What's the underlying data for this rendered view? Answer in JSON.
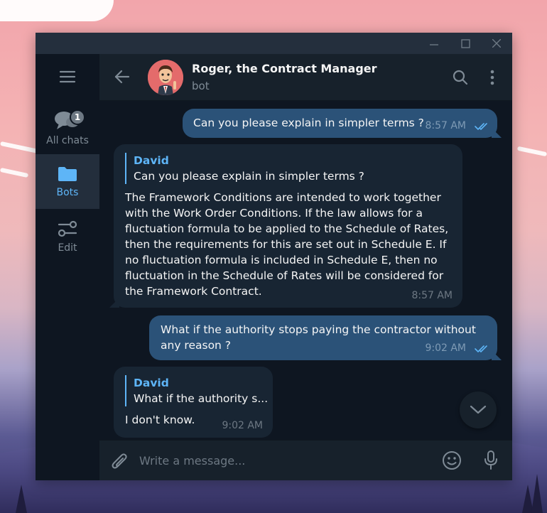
{
  "window": {
    "controls": {
      "minimize": "minimize-icon",
      "maximize": "maximize-icon",
      "close": "close-icon"
    }
  },
  "sidebar": {
    "menu_icon": "hamburger-icon",
    "folders": [
      {
        "label": "All chats",
        "icon": "chats-icon",
        "badge": "1",
        "active": false
      },
      {
        "label": "Bots",
        "icon": "folder-icon",
        "active": true
      },
      {
        "label": "Edit",
        "icon": "sliders-icon",
        "active": false
      }
    ]
  },
  "header": {
    "title": "Roger, the Contract Manager",
    "status": "bot"
  },
  "messages": [
    {
      "direction": "out",
      "text": "Can you please explain in simpler terms ?",
      "time": "8:57 AM",
      "read": true
    },
    {
      "direction": "in",
      "reply_to": {
        "name": "David",
        "text": "Can you please explain in simpler terms ?"
      },
      "lines": [
        "The Framework Conditions are intended to work together",
        "with the Work Order Conditions. If the law allows for a",
        "fluctuation formula to be applied to the Schedule of Rates,",
        "then the requirements for this are set out in Schedule E. If",
        "no fluctuation formula is included in Schedule E, then no",
        "fluctuation in the Schedule of Rates will be considered for",
        "the Framework Contract."
      ],
      "time": "8:57 AM"
    },
    {
      "direction": "out",
      "lines": [
        "What if the authority stops paying the contractor without",
        "any reason ?"
      ],
      "time": "9:02 AM",
      "read": true
    },
    {
      "direction": "in",
      "reply_to": {
        "name": "David",
        "text": "What if the authority s..."
      },
      "text": "I don't know.",
      "time": "9:02 AM"
    }
  ],
  "composer": {
    "placeholder": "Write a message..."
  },
  "colors": {
    "accent": "#5eb5f7",
    "outgoing_bubble": "#2b5278",
    "incoming_bubble": "#182533",
    "background": "#0e1621"
  }
}
